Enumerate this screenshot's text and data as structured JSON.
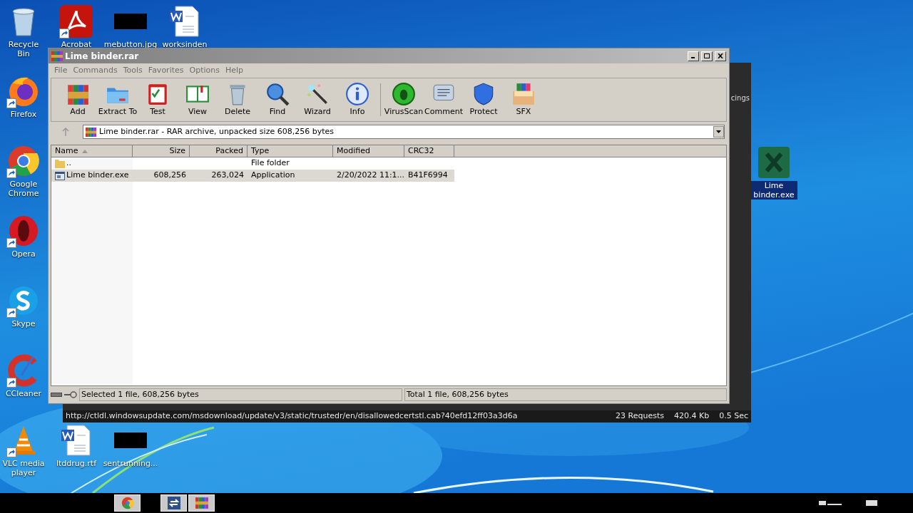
{
  "desktop": {
    "icons": [
      {
        "label": "Recycle Bin",
        "kind": "recycle",
        "shortcut": false,
        "selected": false
      },
      {
        "label": "Acrobat",
        "kind": "pdf",
        "shortcut": true,
        "selected": false
      },
      {
        "label": "mebutton.jpg",
        "kind": "thumb",
        "shortcut": false,
        "selected": false
      },
      {
        "label": "worksinden",
        "kind": "word",
        "shortcut": false,
        "selected": false
      },
      {
        "label": "Firefox",
        "kind": "firefox",
        "shortcut": true,
        "selected": false
      },
      {
        "label": "Google Chrome",
        "kind": "chrome",
        "shortcut": true,
        "selected": false
      },
      {
        "label": "Opera",
        "kind": "opera",
        "shortcut": true,
        "selected": false
      },
      {
        "label": "Skype",
        "kind": "skype",
        "shortcut": true,
        "selected": false
      },
      {
        "label": "CCleaner",
        "kind": "ccleaner",
        "shortcut": true,
        "selected": false
      },
      {
        "label": "VLC media player",
        "kind": "vlc",
        "shortcut": true,
        "selected": false
      },
      {
        "label": "ltddrug.rtf",
        "kind": "word",
        "shortcut": false,
        "selected": false
      },
      {
        "label": "sentrunning...",
        "kind": "thumb",
        "shortcut": false,
        "selected": false
      },
      {
        "label": "Lime binder.exe",
        "kind": "excel",
        "shortcut": false,
        "selected": true
      }
    ]
  },
  "back_window": {
    "side_text": "cings",
    "status_url": "http://ctldl.windowsupdate.com/msdownload/update/v3/static/trustedr/en/disallowedcertstl.cab?40efd12ff03a3d6a",
    "requests": "23 Requests",
    "size": "420.4 Kb",
    "time": "0.5 Sec"
  },
  "window": {
    "title": "Lime binder.rar",
    "menu": [
      "File",
      "Commands",
      "Tools",
      "Favorites",
      "Options",
      "Help"
    ],
    "toolbar": [
      {
        "label": "Add",
        "kind": "add"
      },
      {
        "label": "Extract To",
        "kind": "extract"
      },
      {
        "label": "Test",
        "kind": "test"
      },
      {
        "label": "View",
        "kind": "view"
      },
      {
        "label": "Delete",
        "kind": "delete"
      },
      {
        "label": "Find",
        "kind": "find"
      },
      {
        "label": "Wizard",
        "kind": "wizard"
      },
      {
        "label": "Info",
        "kind": "info"
      },
      {
        "label": "VirusScan",
        "kind": "virusscan"
      },
      {
        "label": "Comment",
        "kind": "comment"
      },
      {
        "label": "Protect",
        "kind": "protect"
      },
      {
        "label": "SFX",
        "kind": "sfx"
      }
    ],
    "address": "Lime binder.rar - RAR archive, unpacked size 608,256 bytes",
    "columns": [
      "Name",
      "Size",
      "Packed",
      "Type",
      "Modified",
      "CRC32"
    ],
    "rows": [
      {
        "kind": "folder",
        "cells": [
          "..",
          "",
          "",
          "File folder",
          "",
          ""
        ],
        "selected": false
      },
      {
        "kind": "exe",
        "cells": [
          "Lime binder.exe",
          "608,256",
          "263,024",
          "Application",
          "2/20/2022 11:1...",
          "B41F6994"
        ],
        "selected": true
      }
    ],
    "status_left": "Selected 1 file, 608,256 bytes",
    "status_right": "Total 1 file, 608,256 bytes"
  },
  "taskbar": {
    "items": [
      {
        "kind": "chrome"
      },
      {
        "kind": "switcher"
      },
      {
        "kind": "winrar"
      }
    ]
  }
}
